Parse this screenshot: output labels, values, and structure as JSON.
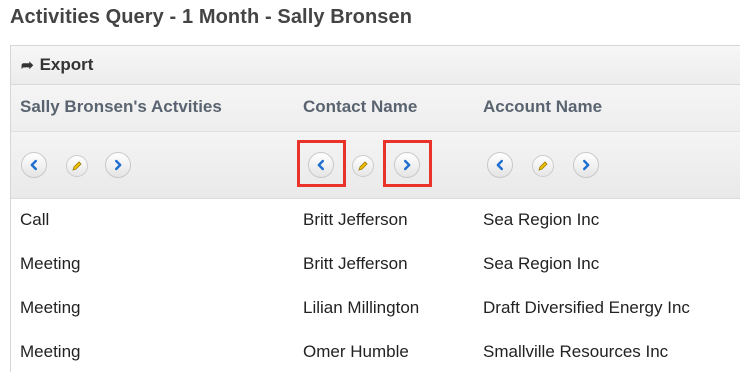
{
  "page": {
    "title": "Activities Query - 1 Month - Sally Bronsen"
  },
  "toolbar": {
    "export_label": "Export"
  },
  "columns": [
    {
      "label": "Sally Bronsen's Actvities"
    },
    {
      "label": "Contact Name"
    },
    {
      "label": "Account Name"
    }
  ],
  "rows": [
    {
      "activity": "Call",
      "contact": "Britt Jefferson",
      "account": "Sea Region Inc"
    },
    {
      "activity": "Meeting",
      "contact": "Britt Jefferson",
      "account": "Sea Region Inc"
    },
    {
      "activity": "Meeting",
      "contact": "Lilian Millington",
      "account": "Draft Diversified Energy Inc"
    },
    {
      "activity": "Meeting",
      "contact": "Omer Humble",
      "account": "Smallville Resources Inc"
    }
  ],
  "colors": {
    "accent_blue": "#1f6fd1",
    "highlight_red": "#e8322a",
    "pencil_yellow": "#f2c200"
  },
  "icons": [
    "export-arrow-icon",
    "chevron-left-icon",
    "pencil-icon",
    "chevron-right-icon"
  ]
}
